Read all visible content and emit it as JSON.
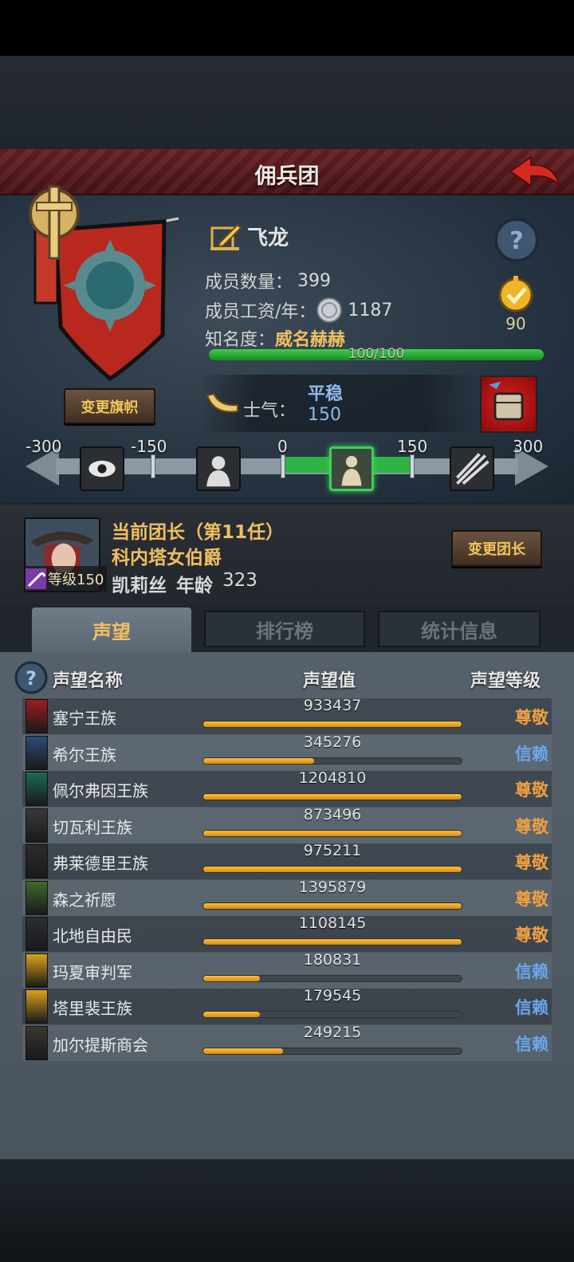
{
  "header": {
    "title": "佣兵团"
  },
  "company": {
    "name": "飞龙",
    "member_count_label": "成员数量：",
    "member_count": "399",
    "salary_label": "成员工资/年：",
    "salary": "1187",
    "fame_label": "知名度：",
    "fame_value": "威名赫赫",
    "fame_progress_text": "100/100",
    "fame_progress": 1.0,
    "score": "90",
    "change_flag_label": "变更旗帜",
    "morale_label": "士气：",
    "morale_state": "平稳",
    "morale_value": "150",
    "morale_ticks": [
      "-300",
      "-150",
      "0",
      "150",
      "300"
    ]
  },
  "leader": {
    "title": "当前团长（第11任）",
    "name": "科内塔女伯爵",
    "level_text": "等级150",
    "person": "凯莉丝",
    "age_label": "年龄",
    "age": "323",
    "change_leader_label": "变更团长"
  },
  "tabs": [
    {
      "label": "声望",
      "active": true
    },
    {
      "label": "排行榜",
      "active": false
    },
    {
      "label": "统计信息",
      "active": false
    }
  ],
  "reputation": {
    "col_name": "声望名称",
    "col_value": "声望值",
    "col_level": "声望等级",
    "rows": [
      {
        "name": "塞宁王族",
        "value": "933437",
        "level": "尊敬",
        "fill": 1.0,
        "crest_color": "#9e1c1c",
        "level_color": "#f0a040"
      },
      {
        "name": "希尔王族",
        "value": "345276",
        "level": "信赖",
        "fill": 0.43,
        "crest_color": "#2a4c78",
        "level_color": "#6aa8f0"
      },
      {
        "name": "佩尔弗因王族",
        "value": "1204810",
        "level": "尊敬",
        "fill": 1.0,
        "crest_color": "#1d6a5a",
        "level_color": "#f0a040"
      },
      {
        "name": "切瓦利王族",
        "value": "873496",
        "level": "尊敬",
        "fill": 1.0,
        "crest_color": "#3a3a3a",
        "level_color": "#f0a040"
      },
      {
        "name": "弗莱德里王族",
        "value": "975211",
        "level": "尊敬",
        "fill": 1.0,
        "crest_color": "#2c2c2c",
        "level_color": "#f0a040"
      },
      {
        "name": "森之祈愿",
        "value": "1395879",
        "level": "尊敬",
        "fill": 1.0,
        "crest_color": "#3f6a2a",
        "level_color": "#f0a040"
      },
      {
        "name": "北地自由民",
        "value": "1108145",
        "level": "尊敬",
        "fill": 1.0,
        "crest_color": "#2a2e33",
        "level_color": "#f0a040"
      },
      {
        "name": "玛夏审判军",
        "value": "180831",
        "level": "信赖",
        "fill": 0.22,
        "crest_color": "#d9a21c",
        "level_color": "#6aa8f0"
      },
      {
        "name": "塔里裴王族",
        "value": "179545",
        "level": "信赖",
        "fill": 0.22,
        "crest_color": "#d9a21c",
        "level_color": "#6aa8f0"
      },
      {
        "name": "加尔提斯商会",
        "value": "249215",
        "level": "信赖",
        "fill": 0.31,
        "crest_color": "#3a3630",
        "level_color": "#6aa8f0"
      }
    ]
  }
}
